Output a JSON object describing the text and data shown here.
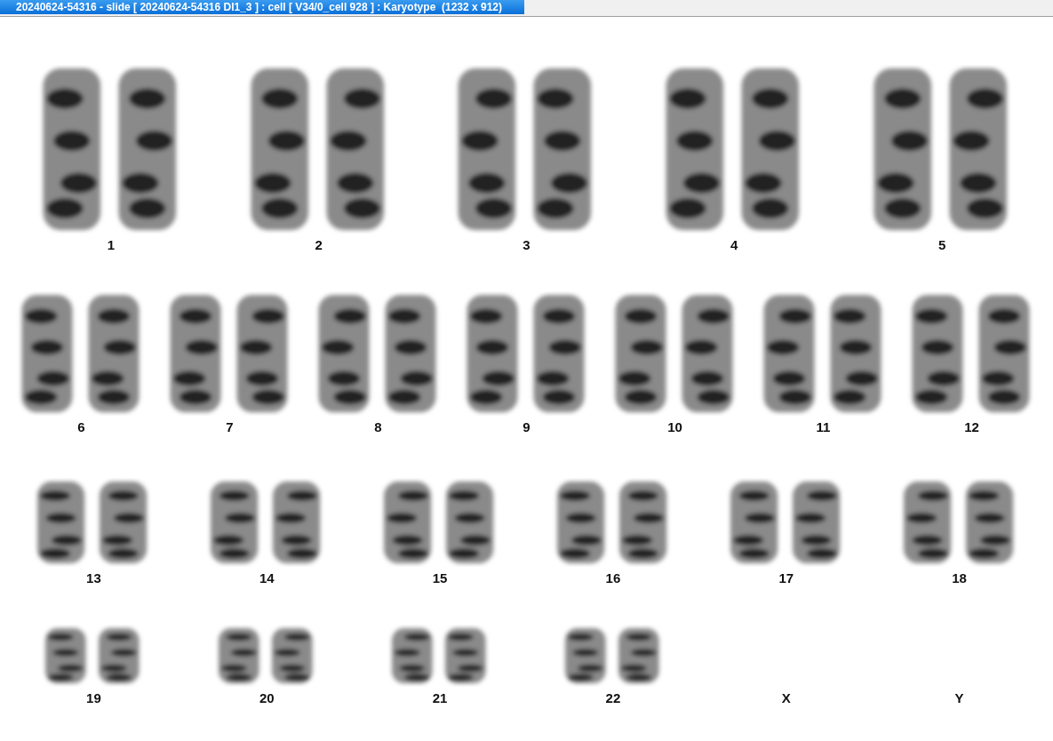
{
  "window": {
    "title": "20240624-54316 - slide [ 20240624-54316 DI1_3 ] : cell [ V34/0_cell 928 ] : Karyotype  (1232 x 912)"
  },
  "karyotype": {
    "rows": [
      [
        {
          "label": "1",
          "kind": "pair"
        },
        {
          "label": "2",
          "kind": "pair"
        },
        {
          "label": "3",
          "kind": "pair"
        },
        {
          "label": "4",
          "kind": "pair"
        },
        {
          "label": "5",
          "kind": "pair"
        }
      ],
      [
        {
          "label": "6",
          "kind": "pair"
        },
        {
          "label": "7",
          "kind": "pair"
        },
        {
          "label": "8",
          "kind": "pair"
        },
        {
          "label": "9",
          "kind": "pair"
        },
        {
          "label": "10",
          "kind": "pair"
        },
        {
          "label": "11",
          "kind": "pair"
        },
        {
          "label": "12",
          "kind": "pair"
        }
      ],
      [
        {
          "label": "13",
          "kind": "pair"
        },
        {
          "label": "14",
          "kind": "pair"
        },
        {
          "label": "15",
          "kind": "pair"
        },
        {
          "label": "16",
          "kind": "pair"
        },
        {
          "label": "17",
          "kind": "pair"
        },
        {
          "label": "18",
          "kind": "pair"
        }
      ],
      [
        {
          "label": "19",
          "kind": "pair"
        },
        {
          "label": "20",
          "kind": "pair"
        },
        {
          "label": "21",
          "kind": "pair"
        },
        {
          "label": "22",
          "kind": "pair"
        },
        {
          "label": "X",
          "kind": "empty"
        },
        {
          "label": "Y",
          "kind": "empty"
        }
      ]
    ]
  }
}
